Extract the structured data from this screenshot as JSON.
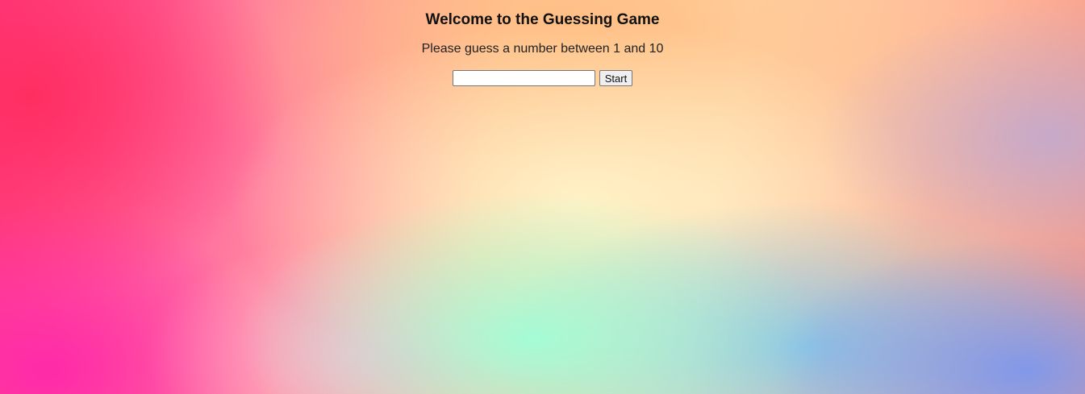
{
  "game": {
    "title": "Welcome to the Guessing Game",
    "prompt": "Please guess a number between 1 and 10",
    "guess_input": {
      "value": "",
      "placeholder": ""
    },
    "start_label": "Start"
  },
  "colors": {
    "background_left": "#ff3a86",
    "background_center": "#ffd9b0",
    "background_bottom_center": "#a0ffd7",
    "background_bottom_right": "#7896f0",
    "text": "#111111",
    "button_bg": "#efefef",
    "input_border": "#767676"
  }
}
